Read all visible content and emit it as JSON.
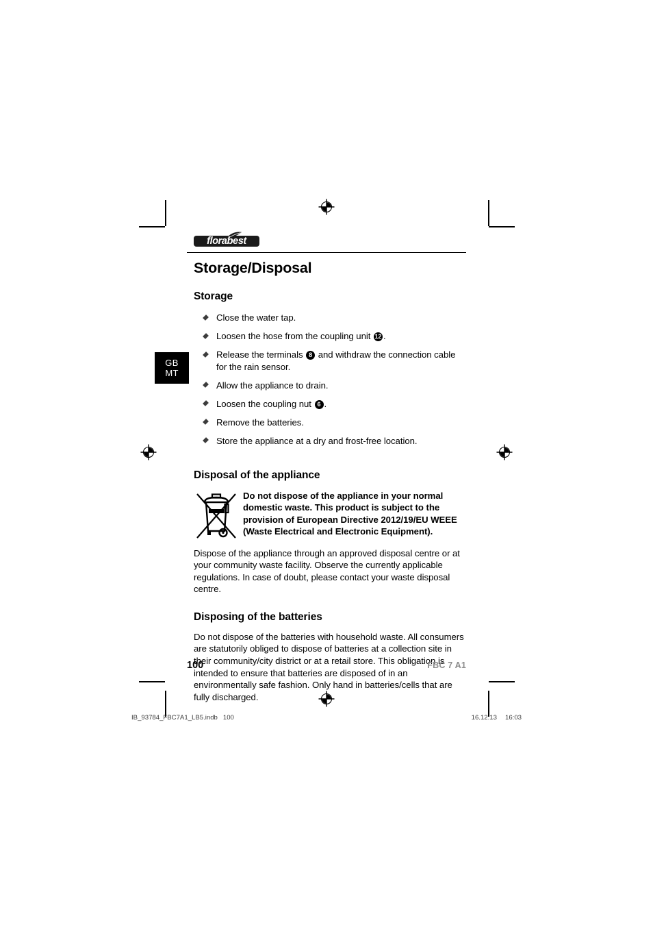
{
  "brand": {
    "logo_text": "florabest",
    "logo_icon": "leaf-icon"
  },
  "language_tab": {
    "line1": "GB",
    "line2": "MT"
  },
  "page": {
    "title": "Storage/Disposal",
    "sections": [
      {
        "heading": "Storage",
        "bullets": [
          {
            "pre": "Close the water tap.",
            "badge": null,
            "post": ""
          },
          {
            "pre": "Loosen the hose from the coupling unit ",
            "badge": "12",
            "post": "."
          },
          {
            "pre": "Release the terminals ",
            "badge": "8",
            "post": " and withdraw the connection cable for the rain sensor."
          },
          {
            "pre": "Allow the appliance to drain.",
            "badge": null,
            "post": ""
          },
          {
            "pre": "Loosen the coupling nut ",
            "badge": "6",
            "post": "."
          },
          {
            "pre": "Remove the batteries.",
            "badge": null,
            "post": ""
          },
          {
            "pre": "Store the appliance at a dry and frost-free location.",
            "badge": null,
            "post": ""
          }
        ]
      },
      {
        "heading": "Disposal of the appliance",
        "icon": "crossed-out-wheelie-bin-icon",
        "notice": "Do not dispose of the appliance in your normal domestic waste. This product is subject to the provision of European Directive 2012/19/EU WEEE (Waste Electrical and Electronic Equipment).",
        "paragraph": "Dispose of the appliance through an approved disposal centre or at your community waste facility. Observe the currently applicable regulations. In case of doubt, please contact your waste disposal centre."
      },
      {
        "heading": "Disposing of the batteries",
        "paragraph": "Do not dispose of the batteries with household waste. All consumers are statutorily obliged to dispose of batteries at a collection site in their community/city district or at a retail store. This obligation is intended to ensure that batteries are disposed of in an environmentally safe fashion. Only hand in batteries/cells that are fully discharged."
      }
    ]
  },
  "footer": {
    "folio": "100",
    "model": "FBC 7 A1"
  },
  "print_footer": {
    "file": "IB_93784_FBC7A1_LB5.indb",
    "file_page": "100",
    "date": "16.12.13",
    "time": "16:03"
  },
  "colors": {
    "text": "#000000",
    "model_gray": "#8c8c8c",
    "tab_bg": "#000000",
    "bullet": "#3c3c3c"
  }
}
